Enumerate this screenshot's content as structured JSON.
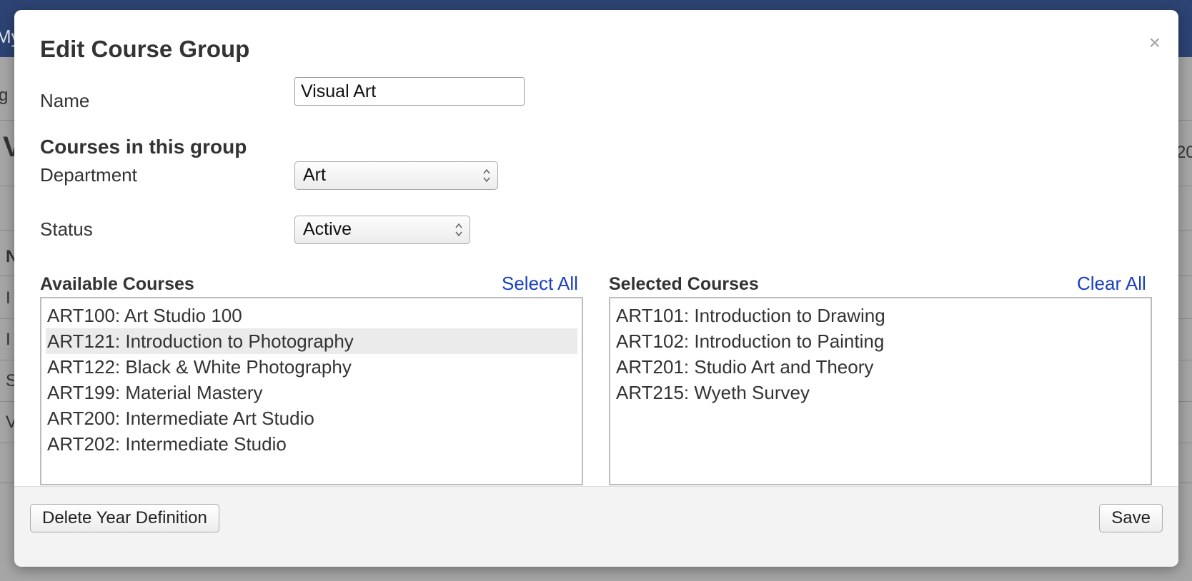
{
  "background": {
    "topbar_text": "My",
    "fragments": [
      "g",
      "V",
      "20",
      "N",
      "I",
      "I",
      "S",
      "V"
    ]
  },
  "modal": {
    "title": "Edit Course Group",
    "close_glyph": "×"
  },
  "form": {
    "name_label": "Name",
    "name_value": "Visual Art",
    "section_heading": "Courses in this group",
    "department_label": "Department",
    "department_value": "Art",
    "status_label": "Status",
    "status_value": "Active"
  },
  "available": {
    "header": "Available Courses",
    "action": "Select All",
    "items": [
      "ART100: Art Studio 100",
      "ART121: Introduction to Photography",
      "ART122: Black & White Photography",
      "ART199: Material Mastery",
      "ART200: Intermediate Art Studio",
      "ART202: Intermediate Studio"
    ]
  },
  "selected": {
    "header": "Selected Courses",
    "action": "Clear All",
    "items": [
      "ART101: Introduction to Drawing",
      "ART102: Introduction to Painting",
      "ART201: Studio Art and Theory",
      "ART215: Wyeth Survey"
    ]
  },
  "footer": {
    "delete_label": "Delete Year Definition",
    "save_label": "Save"
  },
  "colors": {
    "link": "#1a3fbf",
    "topbar": "#2d4373"
  },
  "icons": {
    "close": "close-icon",
    "select_arrows": "select-arrows-icon"
  }
}
